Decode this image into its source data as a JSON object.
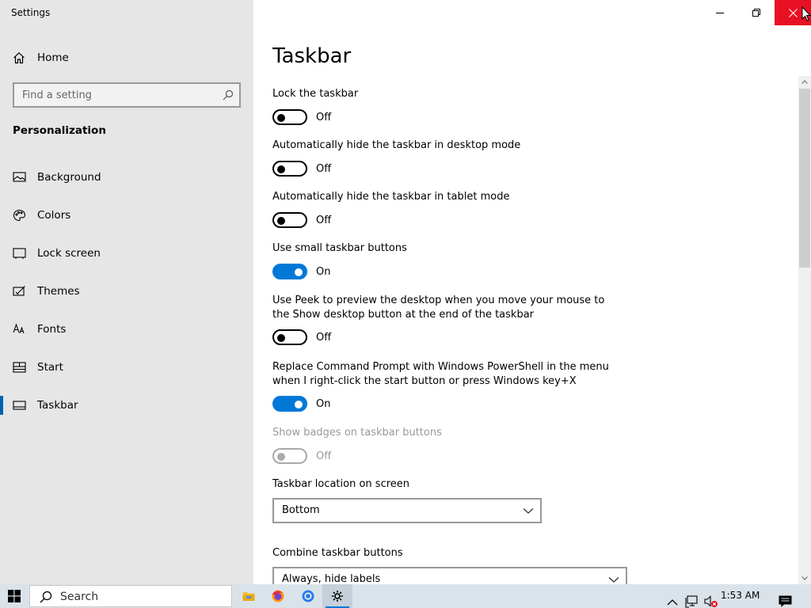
{
  "window": {
    "title": "Settings"
  },
  "nav": {
    "home_label": "Home",
    "search_placeholder": "Find a setting",
    "section_title": "Personalization",
    "items": [
      {
        "label": "Background",
        "icon": "picture-icon"
      },
      {
        "label": "Colors",
        "icon": "palette-icon"
      },
      {
        "label": "Lock screen",
        "icon": "lock-screen-icon"
      },
      {
        "label": "Themes",
        "icon": "themes-icon"
      },
      {
        "label": "Fonts",
        "icon": "fonts-icon"
      },
      {
        "label": "Start",
        "icon": "start-icon"
      },
      {
        "label": "Taskbar",
        "icon": "taskbar-icon",
        "active": true
      }
    ]
  },
  "main": {
    "title": "Taskbar",
    "settings": [
      {
        "label": "Lock the taskbar",
        "state": "Off"
      },
      {
        "label": "Automatically hide the taskbar in desktop mode",
        "state": "Off"
      },
      {
        "label": "Automatically hide the taskbar in tablet mode",
        "state": "Off"
      },
      {
        "label": "Use small taskbar buttons",
        "state": "On"
      },
      {
        "label": "Use Peek to preview the desktop when you move your mouse to the Show desktop button at the end of the taskbar",
        "state": "Off"
      },
      {
        "label": "Replace Command Prompt with Windows PowerShell in the menu when I right-click the start button or press Windows key+X",
        "state": "On"
      },
      {
        "label": "Show badges on taskbar buttons",
        "state": "Off",
        "disabled": true
      }
    ],
    "location": {
      "label": "Taskbar location on screen",
      "value": "Bottom"
    },
    "combine": {
      "label": "Combine taskbar buttons",
      "value": "Always, hide labels"
    }
  },
  "taskbar": {
    "search_text": "Search",
    "clock": "1:53 AM",
    "apps": [
      "file-explorer-icon",
      "firefox-icon",
      "chrome-icon",
      "settings-gear-icon"
    ]
  },
  "colors": {
    "accent": "#0078d7",
    "close_hover": "#e81123",
    "nav_bg": "#e6e6e6"
  }
}
